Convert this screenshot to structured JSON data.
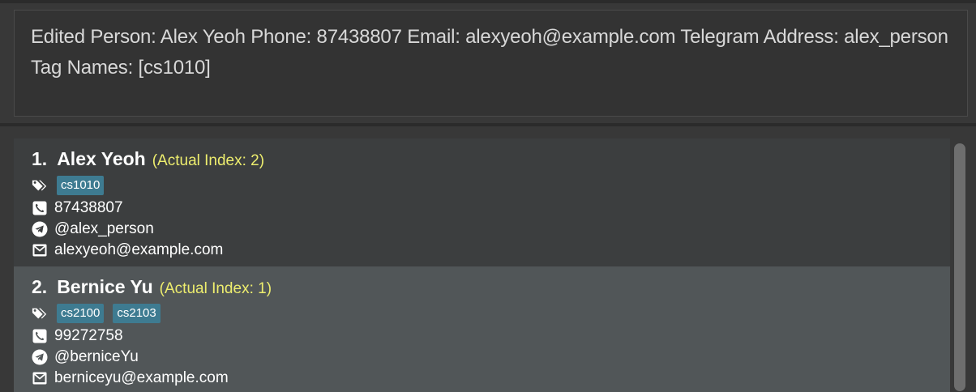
{
  "result": {
    "text": "Edited Person: Alex Yeoh Phone: 87438807 Email: alexyeoh@example.com Telegram Address: alex_person Tag Names: [cs1010]"
  },
  "persons": [
    {
      "index": "1.",
      "name": "Alex Yeoh",
      "actual_index": "(Actual Index: 2)",
      "tags": [
        "cs1010"
      ],
      "phone": "87438807",
      "telegram": "@alex_person",
      "email": "alexyeoh@example.com"
    },
    {
      "index": "2.",
      "name": "Bernice Yu",
      "actual_index": "(Actual Index: 1)",
      "tags": [
        "cs2100",
        "cs2103"
      ],
      "phone": "99272758",
      "telegram": "@berniceYu",
      "email": "berniceyu@example.com"
    }
  ],
  "icons": {
    "tag": "tag-icon",
    "phone": "phone-icon",
    "telegram": "telegram-icon",
    "email": "envelope-icon"
  },
  "colors": {
    "background": "#383838",
    "card_odd": "#3c3e3f",
    "card_even": "#515658",
    "tag": "#3e7b91",
    "actual_index": "#eded6e"
  }
}
